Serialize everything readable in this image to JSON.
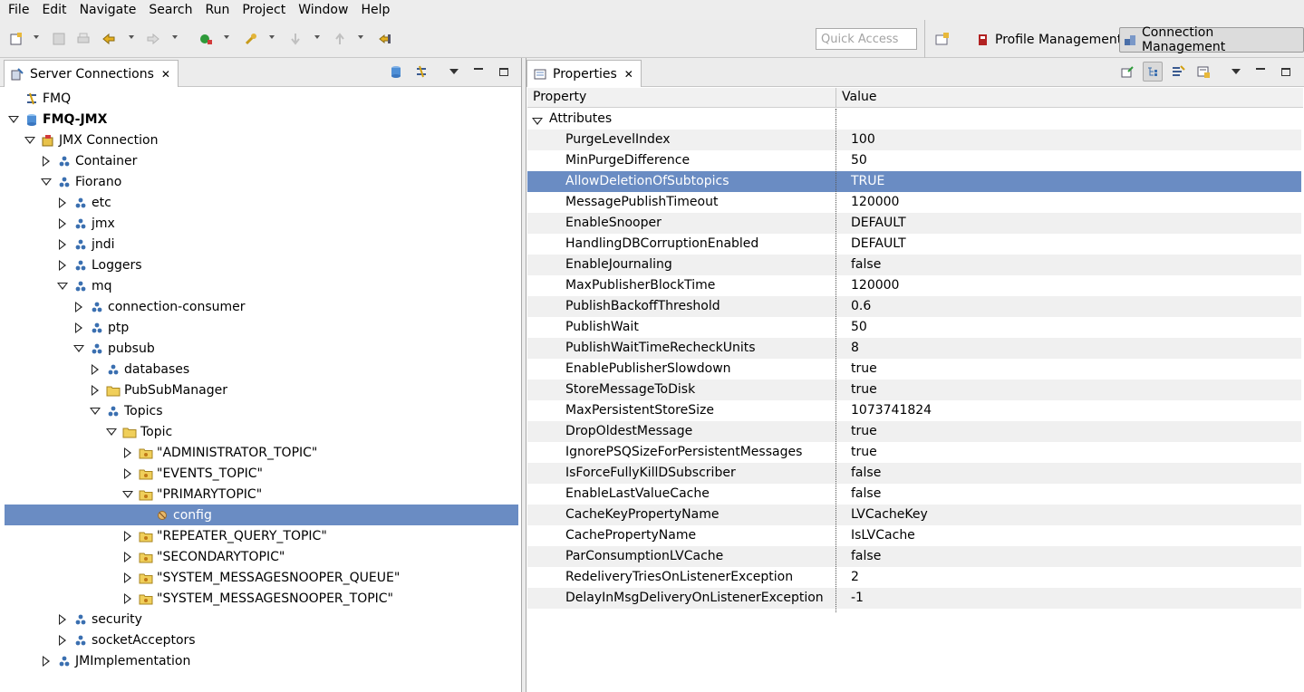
{
  "menu": [
    "File",
    "Edit",
    "Navigate",
    "Search",
    "Run",
    "Project",
    "Window",
    "Help"
  ],
  "toolbar": {
    "quick_access_placeholder": "Quick Access",
    "perspectives": [
      "Profile Management",
      "Connection Management"
    ],
    "active_perspective": "Connection Management"
  },
  "left_view": {
    "title": "Server Connections",
    "tree": [
      {
        "label": "FMQ",
        "depth": 0,
        "toggle": "none",
        "icon": "fmq-server-icon"
      },
      {
        "label": "FMQ-JMX",
        "depth": 0,
        "toggle": "open",
        "icon": "jmx-server-icon",
        "bold": true
      },
      {
        "label": "JMX Connection",
        "depth": 1,
        "toggle": "open",
        "icon": "jmx-connection-icon"
      },
      {
        "label": "Container",
        "depth": 2,
        "toggle": "closed",
        "icon": "domain-icon"
      },
      {
        "label": "Fiorano",
        "depth": 2,
        "toggle": "open",
        "icon": "domain-icon"
      },
      {
        "label": "etc",
        "depth": 3,
        "toggle": "closed",
        "icon": "domain-icon"
      },
      {
        "label": "jmx",
        "depth": 3,
        "toggle": "closed",
        "icon": "domain-icon"
      },
      {
        "label": "jndi",
        "depth": 3,
        "toggle": "closed",
        "icon": "domain-icon"
      },
      {
        "label": "Loggers",
        "depth": 3,
        "toggle": "closed",
        "icon": "domain-icon"
      },
      {
        "label": "mq",
        "depth": 3,
        "toggle": "open",
        "icon": "domain-icon"
      },
      {
        "label": "connection-consumer",
        "depth": 4,
        "toggle": "closed",
        "icon": "domain-icon"
      },
      {
        "label": "ptp",
        "depth": 4,
        "toggle": "closed",
        "icon": "domain-icon"
      },
      {
        "label": "pubsub",
        "depth": 4,
        "toggle": "open",
        "icon": "domain-icon"
      },
      {
        "label": "databases",
        "depth": 5,
        "toggle": "closed",
        "icon": "domain-icon"
      },
      {
        "label": "PubSubManager",
        "depth": 5,
        "toggle": "closed",
        "icon": "folder-icon"
      },
      {
        "label": "Topics",
        "depth": 5,
        "toggle": "open",
        "icon": "domain-icon"
      },
      {
        "label": "Topic",
        "depth": 6,
        "toggle": "open",
        "icon": "folder-icon"
      },
      {
        "label": "\"ADMINISTRATOR_TOPIC\"",
        "depth": 7,
        "toggle": "closed",
        "icon": "mbean-folder-icon"
      },
      {
        "label": "\"EVENTS_TOPIC\"",
        "depth": 7,
        "toggle": "closed",
        "icon": "mbean-folder-icon"
      },
      {
        "label": "\"PRIMARYTOPIC\"",
        "depth": 7,
        "toggle": "open",
        "icon": "mbean-folder-icon"
      },
      {
        "label": "config",
        "depth": 8,
        "toggle": "none",
        "icon": "mbean-icon",
        "selected": true
      },
      {
        "label": "\"REPEATER_QUERY_TOPIC\"",
        "depth": 7,
        "toggle": "closed",
        "icon": "mbean-folder-icon"
      },
      {
        "label": "\"SECONDARYTOPIC\"",
        "depth": 7,
        "toggle": "closed",
        "icon": "mbean-folder-icon"
      },
      {
        "label": "\"SYSTEM_MESSAGESNOOPER_QUEUE\"",
        "depth": 7,
        "toggle": "closed",
        "icon": "mbean-folder-icon"
      },
      {
        "label": "\"SYSTEM_MESSAGESNOOPER_TOPIC\"",
        "depth": 7,
        "toggle": "closed",
        "icon": "mbean-folder-icon"
      },
      {
        "label": "security",
        "depth": 3,
        "toggle": "closed",
        "icon": "domain-icon"
      },
      {
        "label": "socketAcceptors",
        "depth": 3,
        "toggle": "closed",
        "icon": "domain-icon"
      },
      {
        "label": "JMImplementation",
        "depth": 2,
        "toggle": "closed",
        "icon": "domain-icon"
      }
    ]
  },
  "right_view": {
    "title": "Properties",
    "columns": [
      "Property",
      "Value"
    ],
    "group": "Attributes",
    "rows": [
      {
        "name": "PurgeLevelIndex",
        "value": "100"
      },
      {
        "name": "MinPurgeDifference",
        "value": "50"
      },
      {
        "name": "AllowDeletionOfSubtopics",
        "value": "TRUE",
        "selected": true
      },
      {
        "name": "MessagePublishTimeout",
        "value": "120000"
      },
      {
        "name": "EnableSnooper",
        "value": "DEFAULT"
      },
      {
        "name": "HandlingDBCorruptionEnabled",
        "value": "DEFAULT"
      },
      {
        "name": "EnableJournaling",
        "value": "false"
      },
      {
        "name": "MaxPublisherBlockTime",
        "value": "120000"
      },
      {
        "name": "PublishBackoffThreshold",
        "value": "0.6"
      },
      {
        "name": "PublishWait",
        "value": "50"
      },
      {
        "name": "PublishWaitTimeRecheckUnits",
        "value": "8"
      },
      {
        "name": "EnablePublisherSlowdown",
        "value": "true"
      },
      {
        "name": "StoreMessageToDisk",
        "value": "true"
      },
      {
        "name": "MaxPersistentStoreSize",
        "value": "1073741824"
      },
      {
        "name": "DropOldestMessage",
        "value": "true"
      },
      {
        "name": "IgnorePSQSizeForPersistentMessages",
        "value": "true"
      },
      {
        "name": "IsForceFullyKillDSubscriber",
        "value": "false"
      },
      {
        "name": "EnableLastValueCache",
        "value": "false"
      },
      {
        "name": "CacheKeyPropertyName",
        "value": "LVCacheKey"
      },
      {
        "name": "CachePropertyName",
        "value": "IsLVCache"
      },
      {
        "name": "ParConsumptionLVCache",
        "value": "false"
      },
      {
        "name": "RedeliveryTriesOnListenerException",
        "value": "2"
      },
      {
        "name": "DelayInMsgDeliveryOnListenerException",
        "value": "-1"
      }
    ]
  },
  "colors": {
    "selection": "#6a8cc3",
    "alt_row": "#f0f0f0",
    "folder": "#e8c24a",
    "domain_node": "#3a6fb0"
  }
}
